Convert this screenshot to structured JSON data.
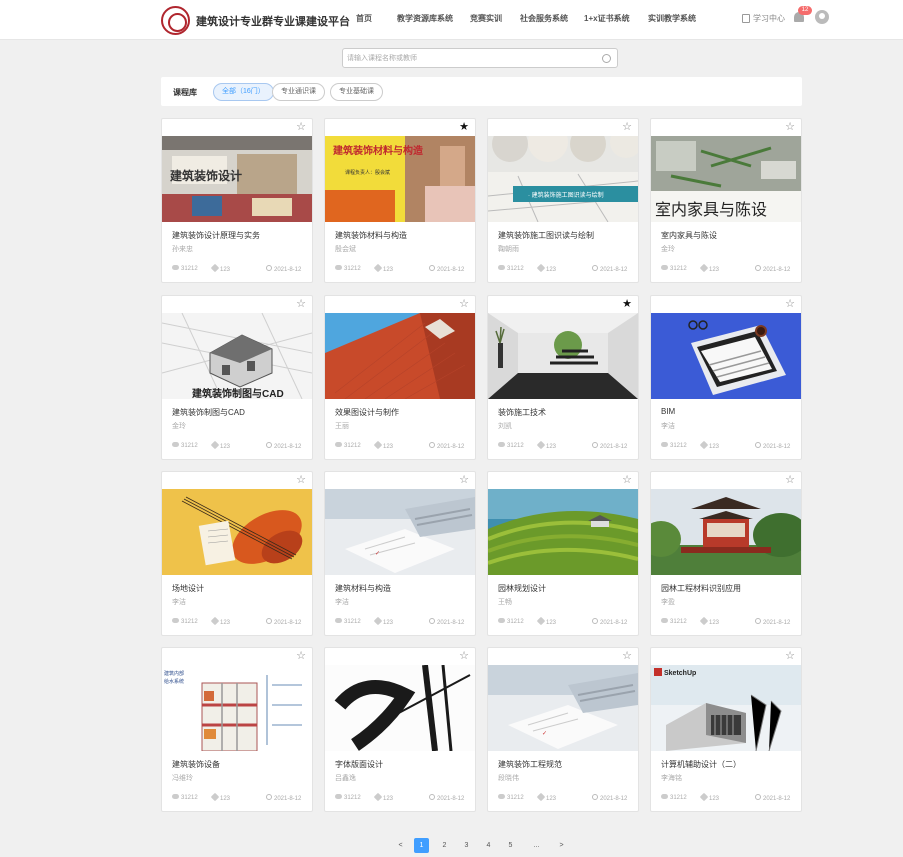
{
  "header": {
    "title": "建筑设计专业群专业课建设平台",
    "nav": [
      "首页",
      "教学资源库系统",
      "竞赛实训",
      "社会服务系统",
      "1+x证书系统",
      "实训教学系统"
    ],
    "study_center": "学习中心",
    "notification_count": "12"
  },
  "search": {
    "placeholder": "请输入课程名称或教师"
  },
  "filter": {
    "label": "课程库",
    "chips": [
      "全部（16门）",
      "专业通识课",
      "专业基础课"
    ],
    "active": 0
  },
  "course_meta": {
    "views": "31212",
    "attachments": "123",
    "date": "2021-8-12"
  },
  "courses": [
    {
      "title": "建筑装饰设计原理与实务",
      "author": "孙来忠",
      "starred": false,
      "thumb_caption": "建筑装饰设计"
    },
    {
      "title": "建筑装饰材料与构造",
      "author": "殷会斌",
      "starred": true,
      "thumb_caption": "建筑装饰材料与构造"
    },
    {
      "title": "建筑装饰施工图识读与绘制",
      "author": "鞠朝雨",
      "starred": false,
      "thumb_caption": "· 建筑装饰施工图识读与绘制"
    },
    {
      "title": "室内家具与陈设",
      "author": "金玲",
      "starred": false,
      "thumb_caption": "室内家具与陈设"
    },
    {
      "title": "建筑装饰制图与CAD",
      "author": "金玲",
      "starred": false,
      "thumb_caption": "建筑装饰制图与CAD"
    },
    {
      "title": "效果图设计与制作",
      "author": "王丽",
      "starred": false,
      "thumb_caption": ""
    },
    {
      "title": "装饰施工技术",
      "author": "刘凯",
      "starred": true,
      "thumb_caption": ""
    },
    {
      "title": "BIM",
      "author": "李洁",
      "starred": false,
      "thumb_caption": ""
    },
    {
      "title": "场地设计",
      "author": "李洁",
      "starred": false,
      "thumb_caption": ""
    },
    {
      "title": "建筑材料与构造",
      "author": "李洁",
      "starred": false,
      "thumb_caption": ""
    },
    {
      "title": "园林规划设计",
      "author": "王畅",
      "starred": false,
      "thumb_caption": ""
    },
    {
      "title": "园林工程材料识别应用",
      "author": "李盈",
      "starred": false,
      "thumb_caption": ""
    },
    {
      "title": "建筑装饰设备",
      "author": "冯维玲",
      "starred": false,
      "thumb_caption": "建筑内部给水系统"
    },
    {
      "title": "字体版面设计",
      "author": "吕鑫逸",
      "starred": false,
      "thumb_caption": ""
    },
    {
      "title": "建筑装饰工程规范",
      "author": "段晓伟",
      "starred": false,
      "thumb_caption": ""
    },
    {
      "title": "计算机辅助设计（二）",
      "author": "李海铭",
      "starred": false,
      "thumb_caption": "SketchUp"
    }
  ],
  "pagination": {
    "prev": "<",
    "pages": [
      "1",
      "2",
      "3",
      "4",
      "5",
      "..."
    ],
    "next": ">",
    "current": "1"
  },
  "colors": {
    "accent": "#409eff",
    "brand": "#b0262e",
    "badge": "#f56c6c"
  }
}
